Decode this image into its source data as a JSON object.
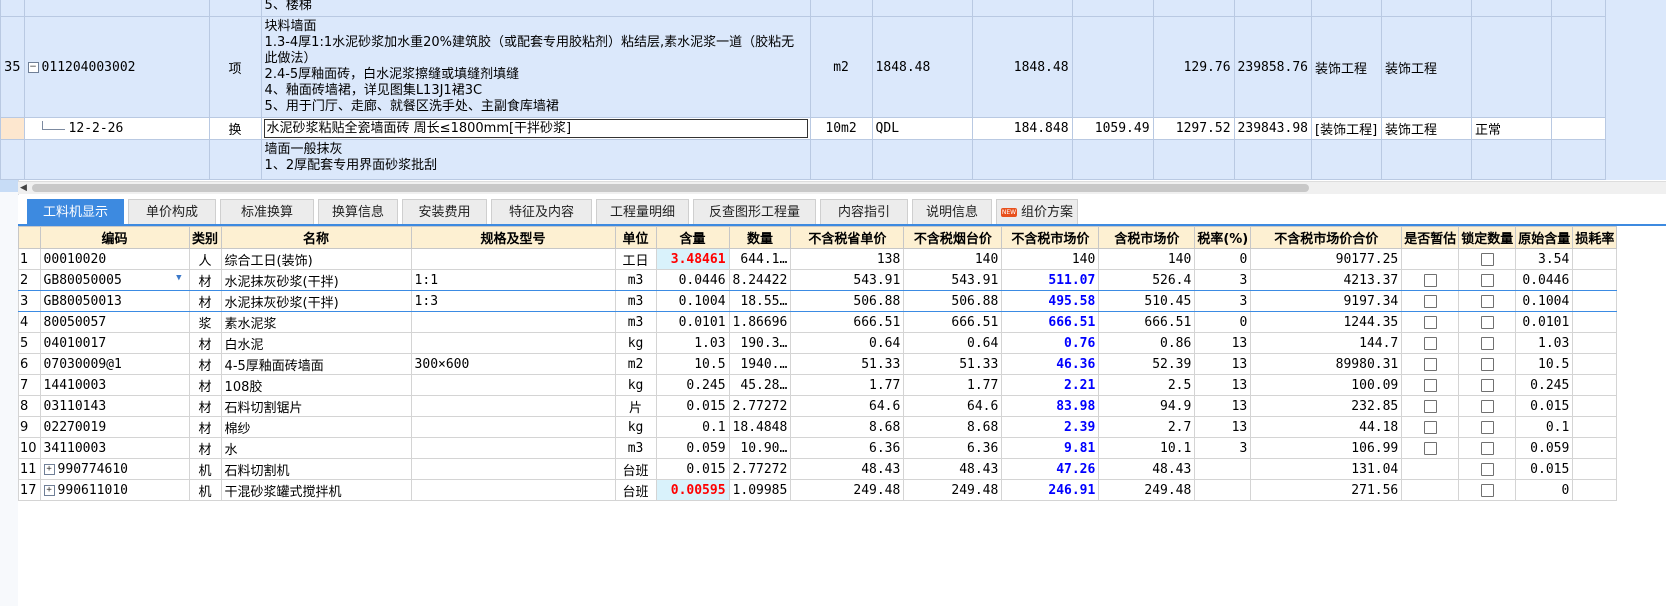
{
  "top_grid": {
    "row0": {
      "desc_tail": "5、楼梯"
    },
    "row35": {
      "num": "35",
      "code": "011204003002",
      "type": "项",
      "desc": [
        "块料墙面",
        "1.3-4厚1:1水泥砂浆加水重20%建筑胶（或配套专用胶粘剂）粘结层,素水泥浆一道（胶粘无此做法）",
        "2.4-5厚釉面砖，白水泥浆擦缝或填缝剂填缝",
        "4、釉面砖墙裙，详见图集L13J1裙3C",
        "5、用于门厅、走廊、就餐区洗手处、主副食库墙裙"
      ],
      "unit": "m2",
      "expr": "1848.48",
      "qty": "1848.48",
      "price": "129.76",
      "total": "239858.76",
      "spec1": "装饰工程",
      "spec2": "装饰工程"
    },
    "sub_row": {
      "code": "12-2-26",
      "type": "换",
      "name": "水泥砂浆粘贴全瓷墙面砖 周长≤1800mm[干拌砂浆]",
      "unit": "10m2",
      "expr": "QDL",
      "qty": "184.848",
      "price1": "1059.49",
      "price2": "1297.52",
      "total": "239843.98",
      "spec1": "[装饰工程]",
      "spec2": "装饰工程",
      "status": "正常"
    },
    "row_next": {
      "desc": [
        "墙面一般抹灰",
        "1、2厚配套专用界面砂浆批刮"
      ]
    }
  },
  "tabs": [
    {
      "label": "工料机显示",
      "active": true
    },
    {
      "label": "单价构成"
    },
    {
      "label": "标准换算"
    },
    {
      "label": "换算信息"
    },
    {
      "label": "安装费用"
    },
    {
      "label": "特征及内容"
    },
    {
      "label": "工程量明细"
    },
    {
      "label": "反查图形工程量"
    },
    {
      "label": "内容指引"
    },
    {
      "label": "说明信息"
    },
    {
      "label": "组价方案",
      "badge": "NEW"
    }
  ],
  "columns": [
    "编码",
    "类别",
    "名称",
    "规格及型号",
    "单位",
    "含量",
    "数量",
    "不含税省单价",
    "不含税烟台价",
    "不含税市场价",
    "含税市场价",
    "税率(%)",
    "不含税市场价合价",
    "是否暂估",
    "锁定数量",
    "原始含量",
    "损耗率"
  ],
  "rows": [
    {
      "no": "1",
      "code": "00010020",
      "cat": "人",
      "name": "综合工日(装饰)",
      "spec": "",
      "unit": "工日",
      "content": "3.48461",
      "qty": "644.1…",
      "p1": "138",
      "p2": "140",
      "p3": "140",
      "p4": "140",
      "tax": "0",
      "total": "90177.25",
      "orig": "3.54"
    },
    {
      "no": "2",
      "code": "GB80050005",
      "cat": "材",
      "name": "水泥抹灰砂浆(干拌)",
      "spec": "1:1",
      "unit": "m3",
      "content": "0.0446",
      "qty": "8.24422",
      "p1": "543.91",
      "p2": "543.91",
      "p3": "511.07",
      "p4": "526.4",
      "tax": "3",
      "total": "4213.37",
      "orig": "0.0446"
    },
    {
      "no": "3",
      "code": "GB80050013",
      "cat": "材",
      "name": "水泥抹灰砂浆(干拌)",
      "spec": "1:3",
      "unit": "m3",
      "content": "0.1004",
      "qty": "18.55…",
      "p1": "506.88",
      "p2": "506.88",
      "p3": "495.58",
      "p4": "510.45",
      "tax": "3",
      "total": "9197.34",
      "orig": "0.1004"
    },
    {
      "no": "4",
      "code": "80050057",
      "cat": "浆",
      "name": "素水泥浆",
      "spec": "",
      "unit": "m3",
      "content": "0.0101",
      "qty": "1.86696",
      "p1": "666.51",
      "p2": "666.51",
      "p3": "666.51",
      "p4": "666.51",
      "tax": "0",
      "total": "1244.35",
      "orig": "0.0101"
    },
    {
      "no": "5",
      "code": "04010017",
      "cat": "材",
      "name": "白水泥",
      "spec": "",
      "unit": "kg",
      "content": "1.03",
      "qty": "190.3…",
      "p1": "0.64",
      "p2": "0.64",
      "p3": "0.76",
      "p4": "0.86",
      "tax": "13",
      "total": "144.7",
      "orig": "1.03"
    },
    {
      "no": "6",
      "code": "07030009@1",
      "cat": "材",
      "name": "4-5厚釉面砖墙面",
      "spec": "300×600",
      "unit": "m2",
      "content": "10.5",
      "qty": "1940.…",
      "p1": "51.33",
      "p2": "51.33",
      "p3": "46.36",
      "p4": "52.39",
      "tax": "13",
      "total": "89980.31",
      "orig": "10.5"
    },
    {
      "no": "7",
      "code": "14410003",
      "cat": "材",
      "name": "108胶",
      "spec": "",
      "unit": "kg",
      "content": "0.245",
      "qty": "45.28…",
      "p1": "1.77",
      "p2": "1.77",
      "p3": "2.21",
      "p4": "2.5",
      "tax": "13",
      "total": "100.09",
      "orig": "0.245"
    },
    {
      "no": "8",
      "code": "03110143",
      "cat": "材",
      "name": "石料切割锯片",
      "spec": "",
      "unit": "片",
      "content": "0.015",
      "qty": "2.77272",
      "p1": "64.6",
      "p2": "64.6",
      "p3": "83.98",
      "p4": "94.9",
      "tax": "13",
      "total": "232.85",
      "orig": "0.015"
    },
    {
      "no": "9",
      "code": "02270019",
      "cat": "材",
      "name": "棉纱",
      "spec": "",
      "unit": "kg",
      "content": "0.1",
      "qty": "18.4848",
      "p1": "8.68",
      "p2": "8.68",
      "p3": "2.39",
      "p4": "2.7",
      "tax": "13",
      "total": "44.18",
      "orig": "0.1"
    },
    {
      "no": "10",
      "code": "34110003",
      "cat": "材",
      "name": "水",
      "spec": "",
      "unit": "m3",
      "content": "0.059",
      "qty": "10.90…",
      "p1": "6.36",
      "p2": "6.36",
      "p3": "9.81",
      "p4": "10.1",
      "tax": "3",
      "total": "106.99",
      "orig": "0.059"
    },
    {
      "no": "11",
      "code": "990774610",
      "cat": "机",
      "name": "石料切割机",
      "spec": "",
      "unit": "台班",
      "content": "0.015",
      "qty": "2.77272",
      "p1": "48.43",
      "p2": "48.43",
      "p3": "47.26",
      "p4": "48.43",
      "tax": "",
      "total": "131.04",
      "orig": "0.015",
      "expand": true
    },
    {
      "no": "17",
      "code": "990611010",
      "cat": "机",
      "name": "干混砂浆罐式搅拌机",
      "spec": "",
      "unit": "台班",
      "content": "0.00595",
      "qty": "1.09985",
      "p1": "249.48",
      "p2": "249.48",
      "p3": "246.91",
      "p4": "249.48",
      "tax": "",
      "total": "271.56",
      "orig": "0",
      "expand": true
    }
  ]
}
